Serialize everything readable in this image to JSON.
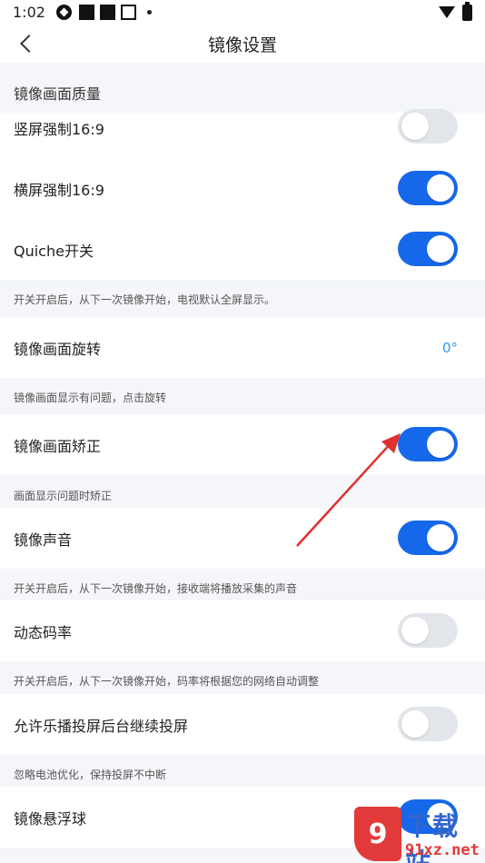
{
  "status_bar": {
    "time": "1:02"
  },
  "header": {
    "title": "镜像设置"
  },
  "sections": {
    "quality_title": "镜像画面质量"
  },
  "settings": {
    "portrait_force": {
      "label": "竖屏强制16:9",
      "on": false
    },
    "landscape_force": {
      "label": "横屏强制16:9",
      "on": true
    },
    "quiche": {
      "label": "Quiche开关",
      "on": true
    },
    "quiche_hint": "开关开启后，从下一次镜像开始，电视默认全屏显示。",
    "rotation": {
      "label": "镜像画面旋转",
      "value": "0°"
    },
    "rotation_hint": "镜像画面显示有问题，点击旋转",
    "correction": {
      "label": "镜像画面矫正",
      "on": true
    },
    "correction_hint": "画面显示问题时矫正",
    "sound": {
      "label": "镜像声音",
      "on": true
    },
    "sound_hint": "开关开启后，从下一次镜像开始，接收端将播放采集的声音",
    "bitrate": {
      "label": "动态码率",
      "on": false
    },
    "bitrate_hint": "开关开启后，从下一次镜像开始，码率将根据您的网络自动调整",
    "background": {
      "label": "允许乐播投屏后台继续投屏",
      "on": false
    },
    "background_hint": "忽略电池优化，保持投屏不中断",
    "floating": {
      "label": "镜像悬浮球",
      "on": true
    }
  },
  "watermark": {
    "logo_glyph": "9",
    "top_text": "下载站",
    "bottom_text": "91xz.net"
  },
  "colors": {
    "accent": "#1668ea",
    "value": "#2a9bf0",
    "arrow": "#e03030"
  }
}
